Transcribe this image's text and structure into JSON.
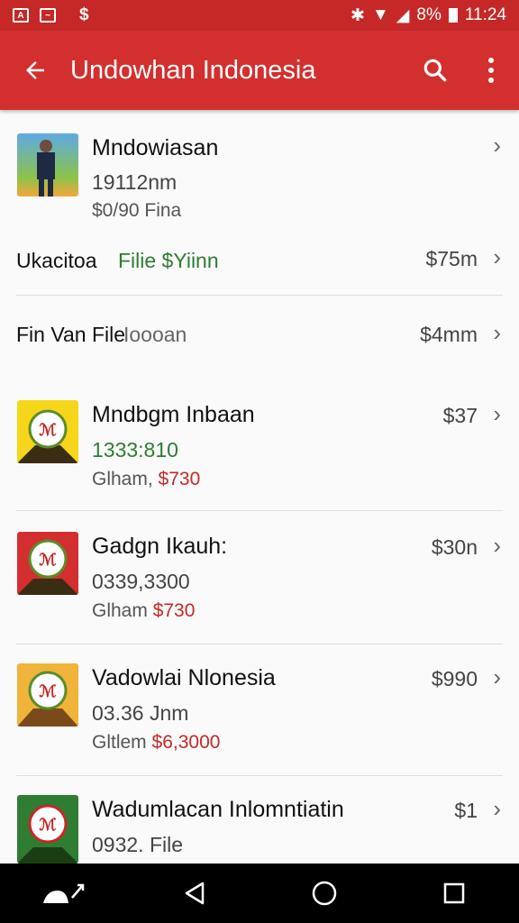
{
  "status_bar": {
    "battery": "8%",
    "time": "11:24"
  },
  "app_bar": {
    "title": "Undowhan Indonesia"
  },
  "items": [
    {
      "title": "Mndowiasan",
      "line1": "19112nm",
      "line2": "$0/90 Fina"
    },
    {
      "title": "Mndbgm Inbaan",
      "price": "$37",
      "line1": "1333:810",
      "line2_prefix": "Glham,",
      "line2_value": "$730"
    },
    {
      "title": "Gadgn Ikauh:",
      "price": "$30n",
      "line1": "0339,3300",
      "line2_prefix": "Glham",
      "line2_value": "$730"
    },
    {
      "title": "Vadowlai Nlonesia",
      "price": "$990",
      "line1": "03.36 Jnm",
      "line2_prefix": "Gltlem",
      "line2_value": "$6,3000"
    },
    {
      "title": "Wadumlacan Inlomntiatin",
      "price": "$1",
      "line1": "0932. File"
    }
  ],
  "info_row_1": {
    "label": "Ukacitoa",
    "value": "Filie $Yiinn",
    "price": "$75m"
  },
  "info_row_2": {
    "label": "Fin Van File",
    "value": "Ioooan",
    "price": "$4mm"
  },
  "colors": {
    "accent": "#d32f2f",
    "status": "#c62828",
    "green": "#2e7d32"
  },
  "icons": [
    "back-arrow-icon",
    "search-icon",
    "more-vert-icon",
    "chevron-right-icon",
    "back-nav-icon",
    "home-nav-icon",
    "recents-nav-icon"
  ]
}
